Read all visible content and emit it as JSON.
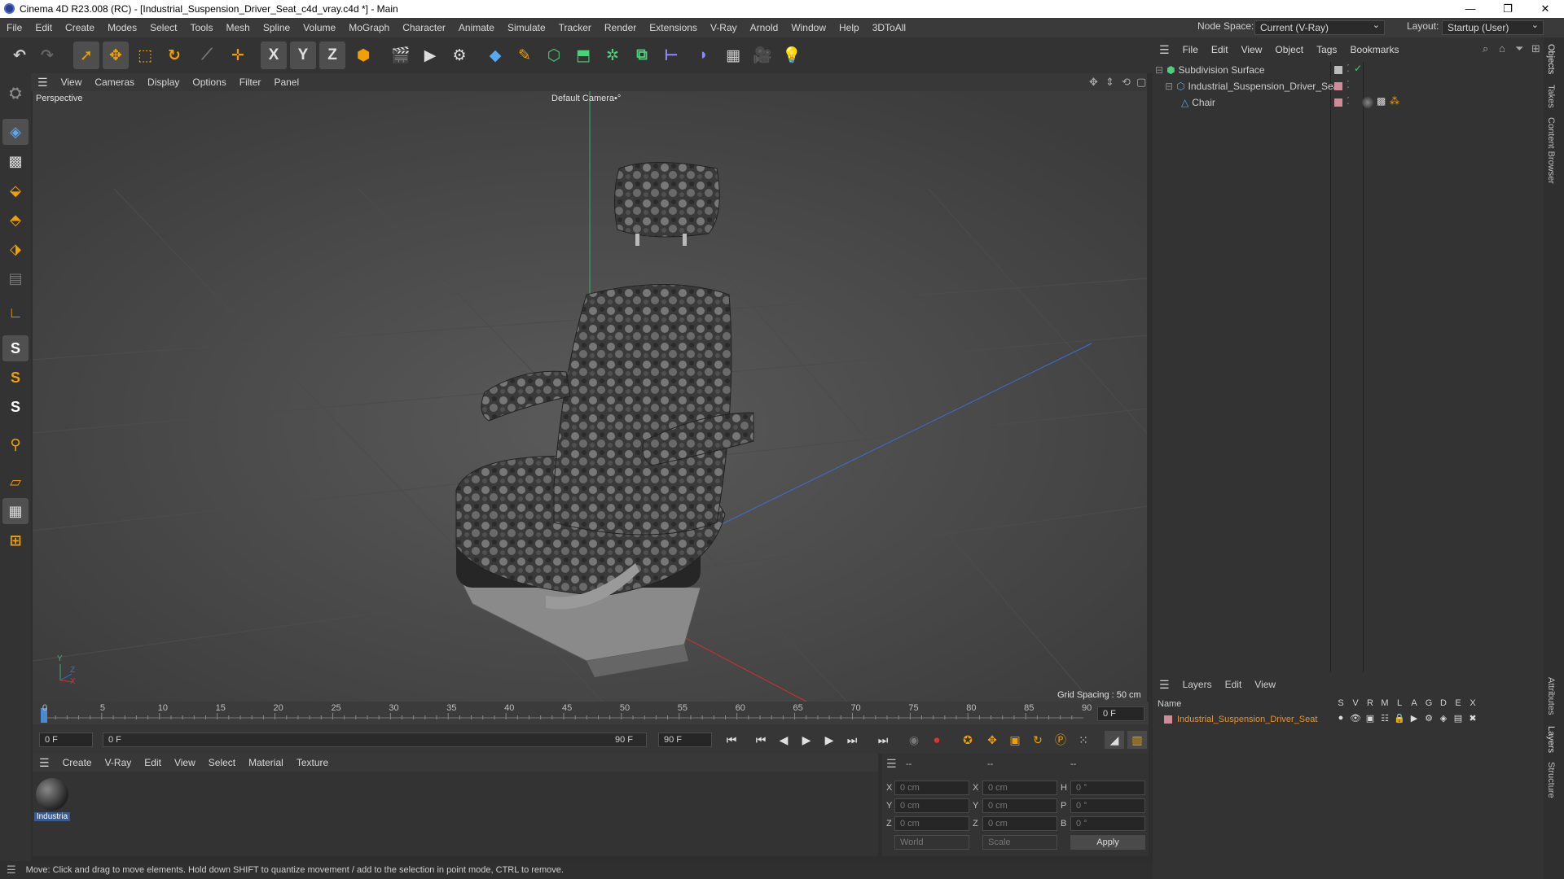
{
  "window": {
    "title": "Cinema 4D R23.008 (RC) - [Industrial_Suspension_Driver_Seat_c4d_vray.c4d *] - Main",
    "min": "—",
    "max": "❐",
    "close": "✕"
  },
  "menu": [
    "File",
    "Edit",
    "Create",
    "Modes",
    "Select",
    "Tools",
    "Mesh",
    "Spline",
    "Volume",
    "MoGraph",
    "Character",
    "Animate",
    "Simulate",
    "Tracker",
    "Render",
    "Extensions",
    "V-Ray",
    "Arnold",
    "Window",
    "Help",
    "3DToAll"
  ],
  "nodespace": {
    "label": "Node Space:",
    "value": "Current (V-Ray)"
  },
  "layout": {
    "label": "Layout:",
    "value": "Startup (User)"
  },
  "viewport": {
    "menu": [
      "View",
      "Cameras",
      "Display",
      "Options",
      "Filter",
      "Panel"
    ],
    "label": "Perspective",
    "camera": "Default Camera",
    "camera_mark": "•°",
    "grid_spacing": "Grid Spacing : 50 cm",
    "axis_y": "Y",
    "axis_z": "Z",
    "axis_x": "X"
  },
  "timeline": {
    "ticks": [
      "0",
      "5",
      "10",
      "15",
      "20",
      "25",
      "30",
      "35",
      "40",
      "45",
      "50",
      "55",
      "60",
      "65",
      "70",
      "75",
      "80",
      "85",
      "90"
    ],
    "current_frame": "0 F",
    "start": "0 F",
    "range_start": "0 F",
    "range_end": "90 F",
    "end": "90 F"
  },
  "materials": {
    "menu": [
      "Create",
      "V-Ray",
      "Edit",
      "View",
      "Select",
      "Material",
      "Texture"
    ],
    "item_label": "Industria"
  },
  "coords": {
    "headers": [
      "--",
      "--",
      "--"
    ],
    "rows": [
      {
        "a": "X",
        "av": "0 cm",
        "b": "X",
        "bv": "0 cm",
        "c": "H",
        "cv": "0 °"
      },
      {
        "a": "Y",
        "av": "0 cm",
        "b": "Y",
        "bv": "0 cm",
        "c": "P",
        "cv": "0 °"
      },
      {
        "a": "Z",
        "av": "0 cm",
        "b": "Z",
        "bv": "0 cm",
        "c": "B",
        "cv": "0 °"
      }
    ],
    "world": "World",
    "scale": "Scale",
    "apply": "Apply"
  },
  "status": "Move: Click and drag to move elements. Hold down SHIFT to quantize movement / add to the selection in point mode, CTRL to remove.",
  "objects": {
    "menu": [
      "File",
      "Edit",
      "View",
      "Object",
      "Tags",
      "Bookmarks"
    ],
    "items": [
      "Subdivision Surface",
      "Industrial_Suspension_Driver_Seat",
      "Chair"
    ]
  },
  "layers": {
    "menu": [
      "Layers",
      "Edit",
      "View"
    ],
    "name_header": "Name",
    "cols": [
      "S",
      "V",
      "R",
      "M",
      "L",
      "A",
      "G",
      "D",
      "E",
      "X"
    ],
    "item": "Industrial_Suspension_Driver_Seat"
  },
  "right_tabs": [
    "Objects",
    "Takes",
    "Content Browser",
    "Attributes",
    "Layers",
    "Structure"
  ],
  "toolbar_axes": [
    "X",
    "Y",
    "Z"
  ],
  "left_tools": [
    "S",
    "S",
    "S"
  ],
  "icons": {
    "undo": "undo-icon",
    "redo": "redo-icon",
    "select": "cursor-icon",
    "move": "move-icon",
    "scale": "scale-icon",
    "rotate": "rotate-icon"
  },
  "colors": {
    "accent": "#f0a000",
    "highlight_orange": "#e8932a",
    "layer_color": "#d08a9a"
  }
}
